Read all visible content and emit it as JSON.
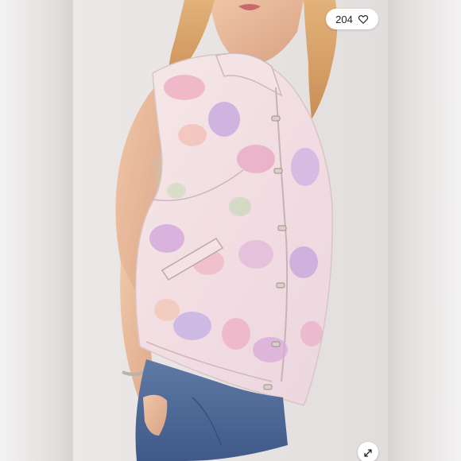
{
  "listing": {
    "likes": "204",
    "like_icon": "heart-outline-icon",
    "expand_icon": "expand-arrows-icon"
  },
  "colors": {
    "background_sides": "#e4e0df",
    "photo_background": "#e7e4e3",
    "vest_base": "#f3e4e4",
    "floral_pink": "#eeb2c6",
    "floral_lavender": "#c6a9dd",
    "denim": "#4f6a96",
    "skin": "#e8b797",
    "hair": "#d9a062"
  }
}
